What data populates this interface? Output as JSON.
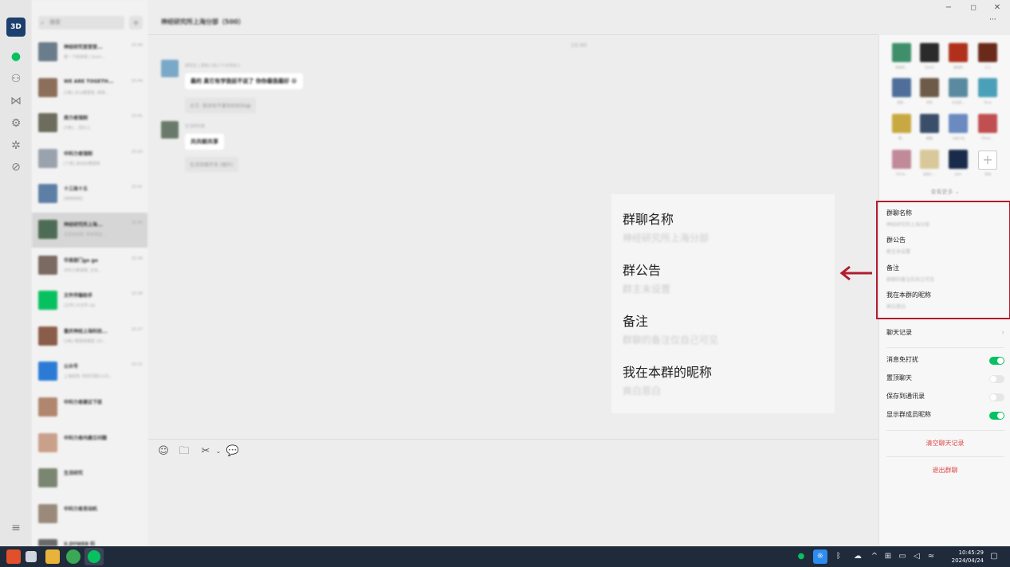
{
  "rail": {
    "logo_text": "3D",
    "icons": [
      "chat-icon",
      "contacts-icon",
      "moments-icon",
      "settings-icon",
      "miniprogram-icon",
      "link-icon",
      "menu-icon"
    ]
  },
  "search": {
    "placeholder": "搜索"
  },
  "conversations": [
    {
      "name": "神经研究室堂堂...",
      "time": "10:44",
      "preview": "某一下班前看 | Soon...",
      "color": "#6b7c8c"
    },
    {
      "name": "WE ARE TOGETH...",
      "time": "10:44",
      "preview": "[3条] 天山哪里呢, 拜拜...",
      "color": "#8b6f5a"
    },
    {
      "name": "周力者强制",
      "time": "10:41",
      "preview": "[5条]... 回头儿",
      "color": "#6d6d5e"
    },
    {
      "name": "中科力者强制",
      "time": "10:43",
      "preview": "[下发] 亲切在哪里呢",
      "color": "#9aa3ad"
    },
    {
      "name": "十三局十五",
      "time": "10:41",
      "preview": "[哈哈哈哈]",
      "color": "#5d7fa5"
    },
    {
      "name": "神经研究所上海...",
      "time": "10:40",
      "preview": "五星级前景, 简单明显...",
      "color": "#4e6b55"
    },
    {
      "name": "华南部门go go",
      "time": "10:36",
      "preview": "中科力者强制, 正在...",
      "color": "#7a6a62"
    },
    {
      "name": "文件传输助手",
      "time": "10:34",
      "preview": "[文件] 大文件.zip",
      "color": "#07c160"
    },
    {
      "name": "重庆神经上海科技...",
      "time": "10:27",
      "preview": "[3条] 哪里呢哪里 (10...",
      "color": "#8a5c4a"
    },
    {
      "name": "公众号",
      "time": "10:21",
      "preview": "上海疫情: 防控问题1(10)...",
      "color": "#2b7bd6"
    },
    {
      "name": "中科力者建议下班",
      "time": "",
      "preview": "",
      "color": "#b0866e"
    },
    {
      "name": "中科力者内建立问题",
      "time": "",
      "preview": "",
      "color": "#c9a08a"
    },
    {
      "name": "生活研究",
      "time": "",
      "preview": "",
      "color": "#7a8670"
    },
    {
      "name": "中科力者发动机",
      "time": "",
      "preview": "",
      "color": "#9a8a7a"
    },
    {
      "name": "X.DYWEB 科",
      "time": "",
      "preview": "",
      "color": "#6a6a6a"
    }
  ],
  "chat": {
    "title": "神经研究所上海分部（500）",
    "timestamp": "10:40",
    "messages": [
      {
        "sender": "研究生 | 周有人的人下文件的人",
        "text": "最的 真它有学我前不说了 你你最我最好 😆",
        "quote": "大王: 我去哈不重你的时间😂"
      },
      {
        "sender": "生活研究者",
        "text": "共共邮共享",
        "quote": "生活到哪开去 (图片)"
      }
    ]
  },
  "zoom_panel": {
    "items": [
      {
        "label": "群聊名称",
        "value": "神经研究所上海分部"
      },
      {
        "label": "群公告",
        "value": "群主未设置"
      },
      {
        "label": "备注",
        "value": "群聊的备注仅自己可见"
      },
      {
        "label": "我在本群的昵称",
        "value": "爽白恩白"
      }
    ]
  },
  "toolbar": {
    "icons": [
      "emoji-icon",
      "folder-icon",
      "scissors-icon",
      "chevron-down-icon",
      "chat-bubble-icon"
    ]
  },
  "members": [
    {
      "name": "神经研...",
      "color": "#3e8f6a"
    },
    {
      "name": "Zoom",
      "color": "#2a2a2a"
    },
    {
      "name": "神经研",
      "color": "#b0301c"
    },
    {
      "name": "小儿",
      "color": "#6a2a1a"
    },
    {
      "name": "我是...",
      "color": "#4f6f9a"
    },
    {
      "name": "阿阿",
      "color": "#6e5a48"
    },
    {
      "name": "文金是...",
      "color": "#5a8aa0"
    },
    {
      "name": "Terry",
      "color": "#4aa0b8"
    },
    {
      "name": "熊...",
      "color": "#c8a840"
    },
    {
      "name": "猫猫",
      "color": "#3a4e6a"
    },
    {
      "name": "小面小宝",
      "color": "#6a8ac0"
    },
    {
      "name": "Ethan...",
      "color": "#c05050"
    },
    {
      "name": "Olivia..",
      "color": "#c08a9a"
    },
    {
      "name": "高端上...",
      "color": "#d8c89a"
    },
    {
      "name": "Jake",
      "color": "#1a2a4a"
    }
  ],
  "panel": {
    "add_label": "添加",
    "see_more": "查看更多",
    "group_name_label": "群聊名称",
    "group_name_value": "神经研究所上海分部",
    "notice_label": "群公告",
    "notice_value": "群主未设置",
    "remark_label": "备注",
    "remark_value": "群聊的备注仅自己可见",
    "nickname_label": "我在本群的昵称",
    "nickname_value": "爽白恩白",
    "chat_history": "聊天记录",
    "mute": "消息免打扰",
    "pin": "置顶聊天",
    "save_contacts": "保存到通讯录",
    "show_nicknames": "显示群成员昵称",
    "toggles": {
      "mute": true,
      "pin": false,
      "save_contacts": false,
      "show_nicknames": true
    },
    "clear_history": "清空聊天记录",
    "exit_group": "退出群聊"
  },
  "window": {
    "more": "···"
  },
  "taskbar": {
    "time": "10:45:29",
    "date": "2024/04/24",
    "apps": [
      "start-icon",
      "files-icon",
      "folder-icon",
      "browser-icon",
      "wechat-icon"
    ]
  },
  "colors": {
    "accent_green": "#07c160",
    "highlight_red": "#b01c2e",
    "danger_red": "#e04a4a"
  }
}
